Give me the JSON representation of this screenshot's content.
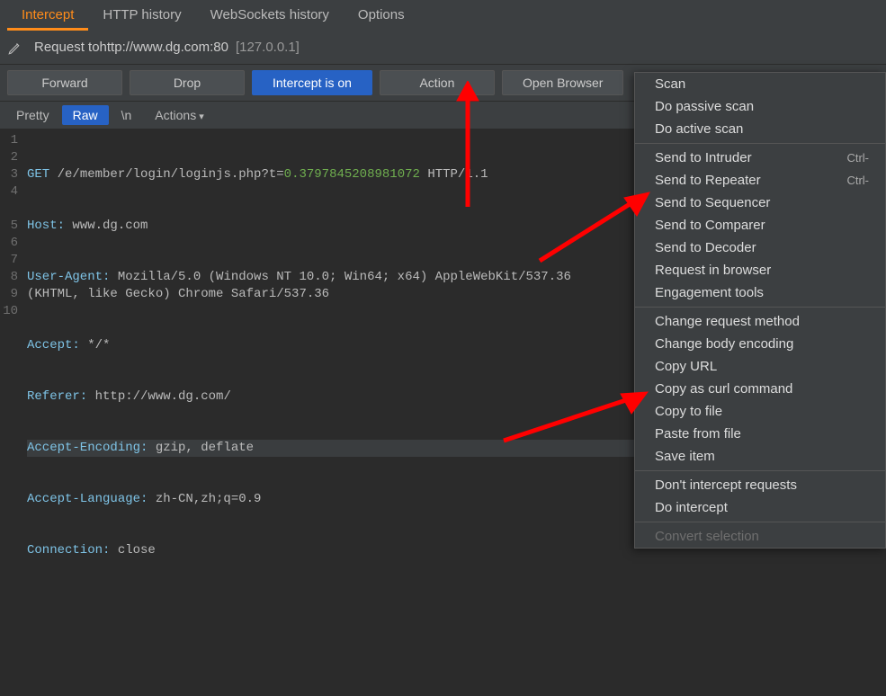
{
  "tabs": {
    "intercept": "Intercept",
    "http_history": "HTTP history",
    "websockets_history": "WebSockets history",
    "options": "Options"
  },
  "request": {
    "label_prefix": "Request to ",
    "host": "http://www.dg.com:80",
    "ip": "[127.0.0.1]"
  },
  "toolbar": {
    "forward": "Forward",
    "drop": "Drop",
    "intercept": "Intercept is on",
    "action": "Action",
    "open_browser": "Open Browser"
  },
  "subtoolbar": {
    "pretty": "Pretty",
    "raw": "Raw",
    "newline": "\\n",
    "actions": "Actions"
  },
  "http": {
    "line1_method": "GET",
    "line1_path": "/e/member/login/loginjs.php?t=",
    "line1_t": "0.3797845208981072",
    "line1_http": "HTTP/1.1",
    "line2_k": "Host:",
    "line2_v": " www.dg.com",
    "line3_k": "User-Agent:",
    "line3_v": " Mozilla/5.0 (Windows NT 10.0; Win64; x64) AppleWebKit/537.36 (KHTML, like Gecko) Chrome Safari/537.36",
    "line4_k": "Accept:",
    "line4_v": " */*",
    "line5_k": "Referer:",
    "line5_v": " http://www.dg.com/",
    "line6_k": "Accept-Encoding:",
    "line6_v": " gzip, deflate",
    "line7_k": "Accept-Language:",
    "line7_v": " zh-CN,zh;q=0.9",
    "line8_k": "Connection:",
    "line8_v": " close"
  },
  "gutter": [
    "1",
    "2",
    "3",
    "4",
    "5",
    "6",
    "7",
    "8",
    "9",
    "10"
  ],
  "menu": {
    "scan": "Scan",
    "passive": "Do passive scan",
    "active": "Do active scan",
    "intruder": "Send to Intruder",
    "intruder_sc": "Ctrl-",
    "repeater": "Send to Repeater",
    "repeater_sc": "Ctrl-",
    "sequencer": "Send to Sequencer",
    "comparer": "Send to Comparer",
    "decoder": "Send to Decoder",
    "req_browser": "Request in browser",
    "engagement": "Engagement tools",
    "change_method": "Change request method",
    "change_body": "Change body encoding",
    "copy_url": "Copy URL",
    "copy_curl": "Copy as curl command",
    "copy_file": "Copy to file",
    "paste_file": "Paste from file",
    "save_item": "Save item",
    "dont_intercept": "Don't intercept requests",
    "do_intercept": "Do intercept",
    "convert_sel": "Convert selection"
  }
}
